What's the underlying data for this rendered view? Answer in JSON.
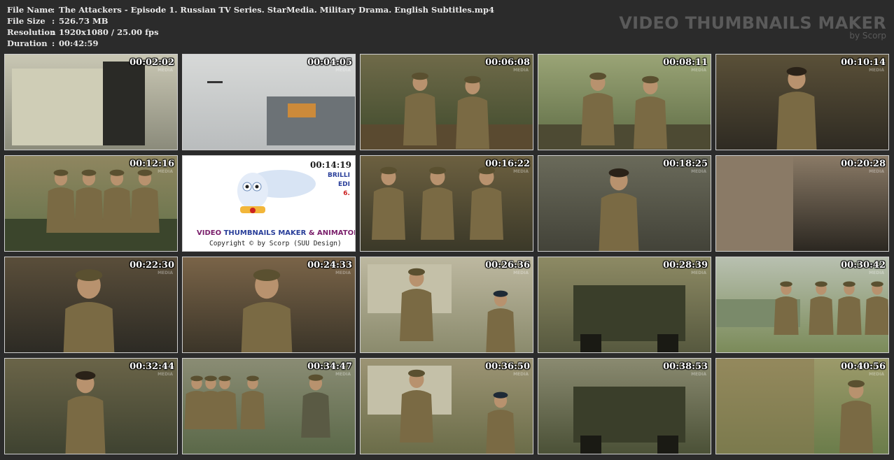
{
  "info": [
    {
      "key": "File Name",
      "value": "The Attackers - Episode 1. Russian TV Series. StarMedia. Military Drama. English Subtitles.mp4"
    },
    {
      "key": "File Size",
      "value": "526.73 MB"
    },
    {
      "key": "Resolution",
      "value": "1920x1080 / 25.00 fps"
    },
    {
      "key": "Duration",
      "value": "00:42:59"
    }
  ],
  "separator": ":",
  "brand": {
    "title": "VIDEO THUMBNAILS MAKER",
    "subtitle": "by Scorp"
  },
  "thumb_watermark": "MEDIA",
  "logo": {
    "title_a": "VIDEO",
    "title_b": "THUMBNAILS MAKER",
    "title_c": "& ANIMATOR",
    "copyright": "Copyright © by Scorp (SUU Design)",
    "side_1": "BRILLI",
    "side_2": "EDI",
    "side_3": "6.",
    "icon": "owl-with-scroll-icon"
  },
  "thumbnails": [
    {
      "time": "00:02:02",
      "scene": "map-table",
      "colors": [
        "#8a8a7a",
        "#c9c7b4",
        "#3a3a34"
      ]
    },
    {
      "time": "00:04:05",
      "scene": "plane-sky",
      "colors": [
        "#b9bcbd",
        "#d7d9d8",
        "#5a6064"
      ]
    },
    {
      "time": "00:06:08",
      "scene": "two-soldiers-field",
      "colors": [
        "#3e4a2c",
        "#6f6a49",
        "#5a4a30"
      ]
    },
    {
      "time": "00:08:11",
      "scene": "two-soldiers-forest",
      "colors": [
        "#5d6b44",
        "#9aa476",
        "#4d4a33"
      ]
    },
    {
      "time": "00:10:14",
      "scene": "woman-interior",
      "colors": [
        "#2e2a22",
        "#5a5038",
        "#8a8067"
      ]
    },
    {
      "time": "00:12:16",
      "scene": "soldiers-lineup",
      "colors": [
        "#607048",
        "#8f8660",
        "#3b452c"
      ]
    },
    {
      "time": "00:14:19",
      "scene": "logo",
      "colors": [
        "#ffffff"
      ]
    },
    {
      "time": "00:16:22",
      "scene": "officers-interior",
      "colors": [
        "#3a3828",
        "#6c6040",
        "#8c7a52"
      ]
    },
    {
      "time": "00:18:25",
      "scene": "woman-barracks",
      "colors": [
        "#424238",
        "#6a6a5a",
        "#2a2a24"
      ]
    },
    {
      "time": "00:20:28",
      "scene": "blurred-closeup",
      "colors": [
        "#2a2620",
        "#8a7a66",
        "#4a4236"
      ]
    },
    {
      "time": "00:22:30",
      "scene": "man-portrait-dark",
      "colors": [
        "#2c2a24",
        "#5a4e3a",
        "#8a7458"
      ]
    },
    {
      "time": "00:24:33",
      "scene": "man-portrait-close",
      "colors": [
        "#3a3428",
        "#7a6448",
        "#a08062"
      ]
    },
    {
      "time": "00:26:36",
      "scene": "tents-soldiers",
      "colors": [
        "#8a8a6c",
        "#bdb8a0",
        "#5a5236"
      ]
    },
    {
      "time": "00:28:39",
      "scene": "truck-field",
      "colors": [
        "#56583e",
        "#8d8a64",
        "#3c3e2c"
      ]
    },
    {
      "time": "00:30:42",
      "scene": "plane-soldiers-field",
      "colors": [
        "#7a8a58",
        "#b8c0b0",
        "#4a5a36"
      ]
    },
    {
      "time": "00:32:44",
      "scene": "woman-truck",
      "colors": [
        "#3e4230",
        "#6a6448",
        "#8a7456"
      ]
    },
    {
      "time": "00:34:47",
      "scene": "soldiers-road",
      "colors": [
        "#5a6848",
        "#8a8c74",
        "#3a402c"
      ]
    },
    {
      "time": "00:36:50",
      "scene": "soldier-tent",
      "colors": [
        "#6a6c48",
        "#9c9474",
        "#4a4a30"
      ]
    },
    {
      "time": "00:38:53",
      "scene": "truck-birches",
      "colors": [
        "#4a5036",
        "#8a8a70",
        "#2e3222"
      ]
    },
    {
      "time": "00:40:56",
      "scene": "woman-fence",
      "colors": [
        "#6a7c4a",
        "#9c9a6a",
        "#3e4a2c"
      ]
    }
  ]
}
